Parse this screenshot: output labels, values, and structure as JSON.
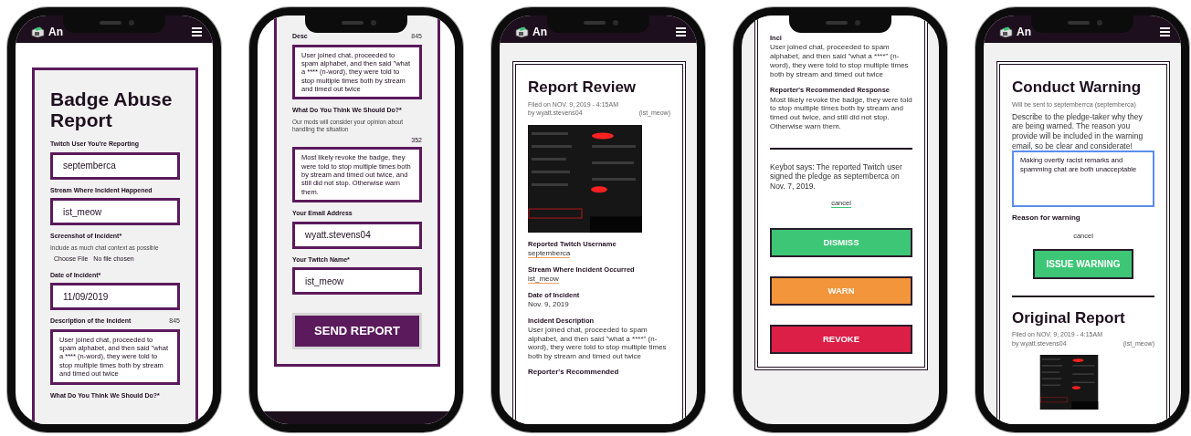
{
  "phones": [
    {
      "header": {
        "logo_text": "An"
      },
      "panel": {
        "kind": "form",
        "open_top": false
      },
      "footer": false,
      "blocks": [
        {
          "kind": "title",
          "text": "Badge Abuse Report"
        },
        {
          "kind": "label",
          "text": "Twitch User You're Reporting"
        },
        {
          "kind": "field",
          "value": "septemberca"
        },
        {
          "kind": "label",
          "text": "Stream Where Incident Happened"
        },
        {
          "kind": "field",
          "value": "ist_meow"
        },
        {
          "kind": "label",
          "text": "Screenshot of Incident*"
        },
        {
          "kind": "hint",
          "text": "Include as much chat context as possible"
        },
        {
          "kind": "file",
          "button": "Choose File",
          "status": "No file chosen"
        },
        {
          "kind": "label",
          "text": "Date of Incident*"
        },
        {
          "kind": "field",
          "value": "11/09/2019"
        },
        {
          "kind": "label",
          "text": "Description of the Incident",
          "count": "845"
        },
        {
          "kind": "textarea",
          "value": "User joined chat, proceeded to spam alphabet, and then said \"what a **** (n-word), they were told to stop multiple times both by stream and timed out twice",
          "focused": false
        },
        {
          "kind": "label",
          "text": "What Do You Think We Should Do?*"
        }
      ]
    },
    {
      "panel": {
        "kind": "form",
        "open_top": true
      },
      "footer": true,
      "blocks": [
        {
          "kind": "label",
          "text": "Desc",
          "count": "845"
        },
        {
          "kind": "textarea",
          "value": "User joined chat, proceeded to spam alphabet, and then said \"what a **** (n-word), they were told to stop multiple times both by stream and timed out twice",
          "focused": false
        },
        {
          "kind": "label",
          "text": "What Do You Think We Should Do?*"
        },
        {
          "kind": "hint",
          "text": "Our mods will consider your opinion about handling the situation"
        },
        {
          "kind": "count",
          "text": "352"
        },
        {
          "kind": "textarea",
          "value": "Most likely revoke the badge, they were told to stop multiple times both by stream and timed out twice, and still did not stop. Otherwise warn them.",
          "focused": false
        },
        {
          "kind": "label",
          "text": "Your Email Address"
        },
        {
          "kind": "field",
          "value": "wyatt.stevens04"
        },
        {
          "kind": "label",
          "text": "Your Twitch Name*"
        },
        {
          "kind": "field",
          "value": "ist_meow"
        },
        {
          "kind": "submit",
          "text": "SEND REPORT"
        }
      ]
    },
    {
      "header": {
        "logo_text": "An"
      },
      "panel": {
        "kind": "review",
        "open_top": false
      },
      "footer": false,
      "blocks": [
        {
          "kind": "title",
          "text": "Report Review"
        },
        {
          "kind": "meta",
          "filed": "Filed on NOV. 9, 2019 - 4:15AM",
          "by": "by wyatt.stevens04",
          "handle": "(ist_meow)"
        },
        {
          "kind": "picture"
        },
        {
          "kind": "detail",
          "label": "Reported Twitch Username",
          "value": "septemberca",
          "underlined": true
        },
        {
          "kind": "detail",
          "label": "Stream Where Incident Occurred",
          "value": "ist_meow",
          "underlined": true
        },
        {
          "kind": "detail",
          "label": "Date of Incident",
          "value": "Nov. 9, 2019",
          "underlined": false
        },
        {
          "kind": "detail",
          "label": "Incident Description",
          "value": "User joined chat, proceeded to spam alphabet, and then said \"what a ****\" (n-word), they were told to stop multiple times both by stream and timed out twice",
          "underlined": false
        },
        {
          "kind": "heading",
          "text": "Reporter's Recommended"
        }
      ]
    },
    {
      "panel": {
        "kind": "review",
        "open_top": true
      },
      "footer": false,
      "blocks": [
        {
          "kind": "detail",
          "label": "Inci",
          "value": "User joined chat, proceeded to spam alphabet, and then said \"what a ****\" (n-word), they were told to stop multiple times both by stream and timed out twice",
          "underlined": false
        },
        {
          "kind": "detail",
          "label": "Reporter's Recommended Response",
          "value": "Most likely revoke the badge, they were told to stop multiple times both by stream and timed out twice, and still did not stop. Otherwise warn them.",
          "underlined": false
        },
        {
          "kind": "divider"
        },
        {
          "kind": "paragraph",
          "text": "Keybot says: The reported Twitch user signed the pledge as septemberca on Nov. 7, 2019."
        },
        {
          "kind": "link",
          "text": "cancel",
          "underlined": true
        },
        {
          "kind": "action",
          "text": "DISMISS",
          "color": "#3cc675"
        },
        {
          "kind": "action",
          "text": "WARN",
          "color": "#f2953b"
        },
        {
          "kind": "action",
          "text": "REVOKE",
          "color": "#dc1f47"
        }
      ]
    },
    {
      "header": {
        "logo_text": "An"
      },
      "panel": {
        "kind": "review",
        "open_top": false
      },
      "footer": false,
      "blocks": [
        {
          "kind": "title",
          "text": "Conduct Warning"
        },
        {
          "kind": "small",
          "text": "Will be sent to septemberrca (septemberca)"
        },
        {
          "kind": "paragraph",
          "text": "Describe to the pledge-taker why they are being warned. The reason you provide will be included in the warning email, so be clear and considerate!"
        },
        {
          "kind": "textarea",
          "value": "Making overtly racist remarks and spamming chat are both unacceptable",
          "focused": true
        },
        {
          "kind": "heading",
          "text": "Reason for warning"
        },
        {
          "kind": "link",
          "text": "cancel",
          "underlined": false
        },
        {
          "kind": "issue",
          "text": "ISSUE WARNING",
          "color": "#3cc675"
        },
        {
          "kind": "divider"
        },
        {
          "kind": "title",
          "text": "Original Report"
        },
        {
          "kind": "meta",
          "filed": "Filed on NOV. 9, 2019 - 4:15AM",
          "by": "by wyatt.stevens04",
          "handle": "(ist_meow)"
        },
        {
          "kind": "picture"
        }
      ]
    }
  ]
}
